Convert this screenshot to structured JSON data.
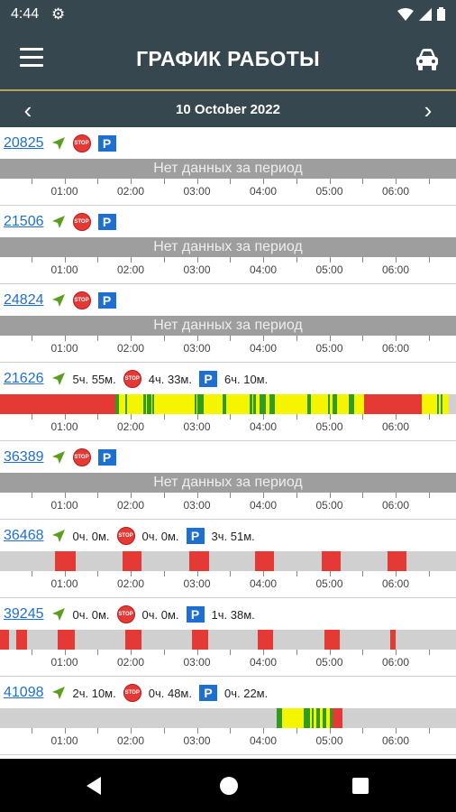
{
  "status_bar": {
    "time": "4:44",
    "icons": [
      "gear-icon",
      "wifi-icon",
      "signal-icon",
      "battery-icon"
    ]
  },
  "app_bar": {
    "title": "ГРАФИК РАБОТЫ",
    "menu_icon": "menu-icon",
    "car_icon": "car-icon"
  },
  "date_bar": {
    "date": "10 October 2022",
    "prev": "‹",
    "next": "›"
  },
  "hour_labels": [
    "01:00",
    "02:00",
    "03:00",
    "04:00",
    "05:00",
    "06:00"
  ],
  "no_data_text": "Нет данных за период",
  "colors": {
    "red": "#e53935",
    "yellow": "#f5f500",
    "green": "#2e9d1e",
    "gray": "#d0d0d0",
    "nodata": "#9e9e9e",
    "blue": "#1e6fd2"
  },
  "vehicles": [
    {
      "id": "20825",
      "has_data": false,
      "move": "",
      "stop": "",
      "park": "",
      "segments": []
    },
    {
      "id": "21506",
      "has_data": false,
      "move": "",
      "stop": "",
      "park": "",
      "segments": []
    },
    {
      "id": "24824",
      "has_data": false,
      "move": "",
      "stop": "",
      "park": "",
      "segments": []
    },
    {
      "id": "21626",
      "has_data": true,
      "move": "5ч. 55м.",
      "stop": "4ч. 33м.",
      "park": "6ч. 10м.",
      "segments": [
        {
          "from": 0.0,
          "to": 1.77,
          "color": "red"
        },
        {
          "from": 1.77,
          "to": 5.52,
          "color": "mixed"
        },
        {
          "from": 5.52,
          "to": 6.39,
          "color": "red"
        },
        {
          "from": 6.39,
          "to": 6.8,
          "color": "mixed"
        }
      ]
    },
    {
      "id": "36389",
      "has_data": false,
      "move": "",
      "stop": "",
      "park": "",
      "segments": []
    },
    {
      "id": "36468",
      "has_data": true,
      "move": "0ч. 0м.",
      "stop": "0ч. 0м.",
      "park": "3ч. 51м.",
      "segments": [
        {
          "from": 0.86,
          "to": 1.17,
          "color": "red"
        },
        {
          "from": 1.88,
          "to": 2.17,
          "color": "red"
        },
        {
          "from": 2.88,
          "to": 3.18,
          "color": "red"
        },
        {
          "from": 3.88,
          "to": 4.17,
          "color": "red"
        },
        {
          "from": 4.88,
          "to": 5.17,
          "color": "red"
        },
        {
          "from": 5.88,
          "to": 6.17,
          "color": "red"
        }
      ]
    },
    {
      "id": "39245",
      "has_data": true,
      "move": "0ч. 0м.",
      "stop": "0ч. 0м.",
      "park": "1ч. 38м.",
      "segments": [
        {
          "from": 0.0,
          "to": 0.17,
          "color": "red"
        },
        {
          "from": 0.27,
          "to": 0.43,
          "color": "red"
        },
        {
          "from": 0.9,
          "to": 1.15,
          "color": "red"
        },
        {
          "from": 1.92,
          "to": 2.17,
          "color": "red"
        },
        {
          "from": 2.92,
          "to": 3.17,
          "color": "red"
        },
        {
          "from": 3.92,
          "to": 4.15,
          "color": "red"
        },
        {
          "from": 4.92,
          "to": 5.15,
          "color": "red"
        },
        {
          "from": 5.92,
          "to": 6.0,
          "color": "red"
        }
      ]
    },
    {
      "id": "41098",
      "has_data": true,
      "move": "2ч. 10м.",
      "stop": "0ч. 48м.",
      "park": "0ч. 22м.",
      "segments": [
        {
          "from": 4.2,
          "to": 4.4,
          "color": "mixed"
        },
        {
          "from": 4.4,
          "to": 5.05,
          "color": "mixed"
        },
        {
          "from": 5.05,
          "to": 5.2,
          "color": "red"
        }
      ]
    }
  ]
}
